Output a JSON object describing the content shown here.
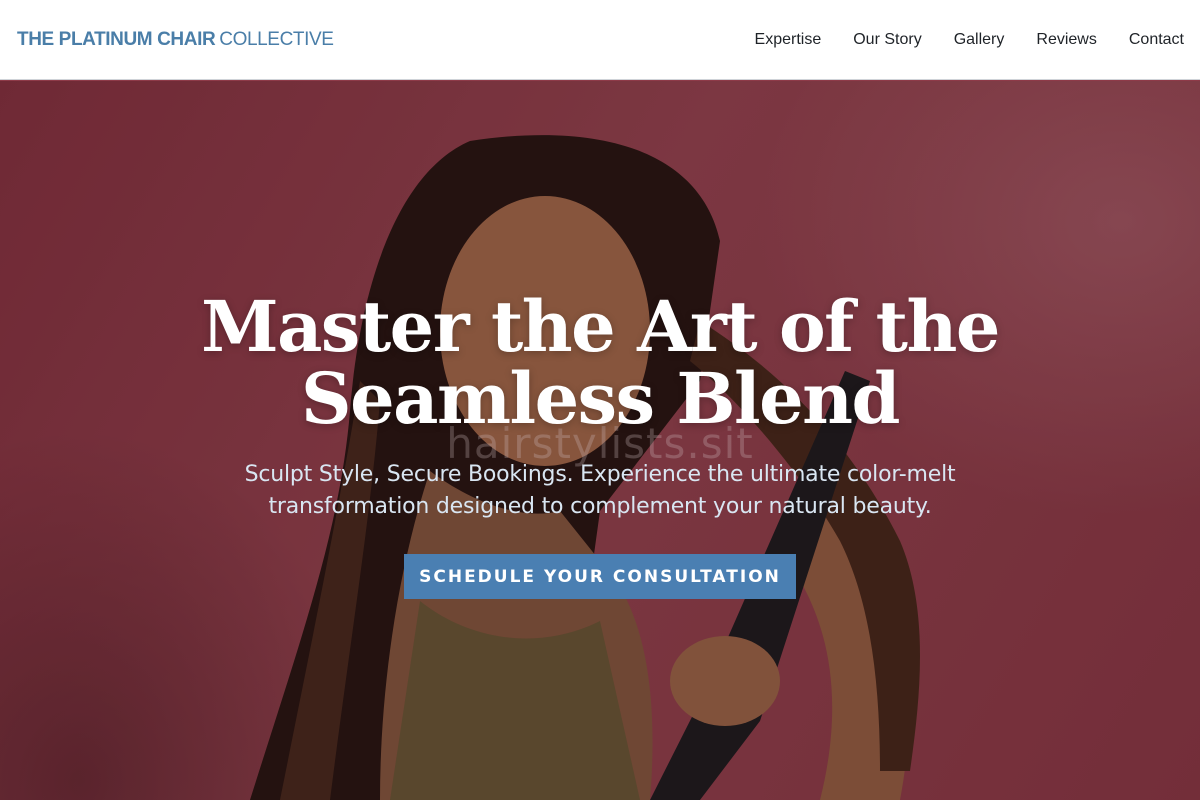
{
  "header": {
    "brand_bold": "THE PLATINUM CHAIR",
    "brand_light": "COLLECTIVE",
    "nav": [
      {
        "label": "Expertise"
      },
      {
        "label": "Our Story"
      },
      {
        "label": "Gallery"
      },
      {
        "label": "Reviews"
      },
      {
        "label": "Contact"
      }
    ]
  },
  "hero": {
    "title_line1": "Master the Art of the",
    "title_line2": "Seamless Blend",
    "subtitle_line1": "Sculpt Style, Secure Bookings. Experience the ultimate color-melt",
    "subtitle_line2": "transformation designed to complement your natural beauty.",
    "watermark": "hairstylists.sit",
    "cta_label": "SCHEDULE YOUR CONSULTATION",
    "photo_icon": "woman-with-straightener-photo"
  },
  "colors": {
    "brand": "#4a7ea8",
    "cta": "#4a7fb2",
    "hero_bg": "#8e3a48",
    "subtitle": "#d9e6f2"
  }
}
